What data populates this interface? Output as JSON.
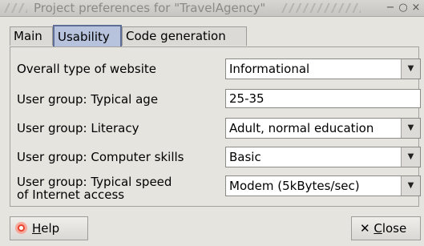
{
  "window": {
    "title": "Project preferences for \"TravelAgency\"",
    "controls": {
      "minimize": "−",
      "maximize": "○",
      "close": "×"
    }
  },
  "tabs": [
    {
      "label": "Main",
      "active": false
    },
    {
      "label": "Usability",
      "active": true
    },
    {
      "label": "Code generation",
      "active": false
    }
  ],
  "form": {
    "website_type": {
      "label": "Overall type of website",
      "value": "Informational"
    },
    "age": {
      "label": "User group: Typical age",
      "value": "25-35"
    },
    "literacy": {
      "label": "User group: Literacy",
      "value": "Adult, normal education"
    },
    "skills": {
      "label": "User group: Computer skills",
      "value": "Basic"
    },
    "speed": {
      "label_line1": "User group: Typical speed",
      "label_line2": "of Internet access",
      "value": "Modem (5kBytes/sec)"
    }
  },
  "buttons": {
    "help": {
      "mnemonic": "H",
      "rest": "elp",
      "icon": "lifebuoy-icon"
    },
    "close": {
      "prefix": "✕ ",
      "mnemonic": "C",
      "rest": "lose",
      "icon": "close-icon"
    }
  },
  "icons": {
    "dropdown": "▼"
  },
  "colors": {
    "window_bg": "#e6e4df",
    "active_tab_bg": "#b7c3dd",
    "active_tab_border": "#5e6e96",
    "help_icon": "#e8412b"
  }
}
